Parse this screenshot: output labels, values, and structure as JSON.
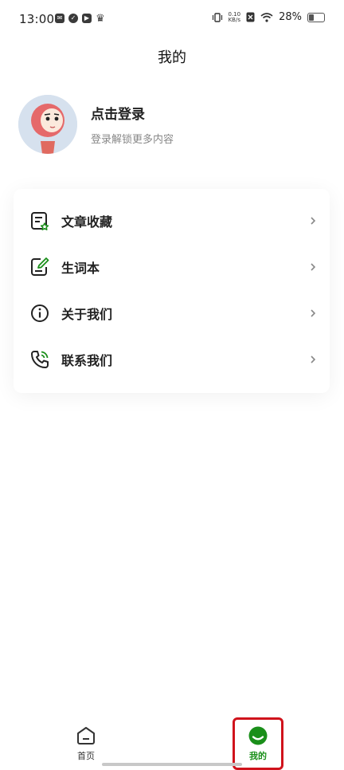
{
  "status_bar": {
    "time": "13:00",
    "net_speed_value": "0.10",
    "net_speed_unit": "KB/s",
    "battery": "28%"
  },
  "page": {
    "title": "我的"
  },
  "profile": {
    "login_title": "点击登录",
    "login_subtitle": "登录解锁更多内容"
  },
  "menu": {
    "items": [
      {
        "label": "文章收藏",
        "icon": "article-bookmark-icon"
      },
      {
        "label": "生词本",
        "icon": "vocabulary-notebook-icon"
      },
      {
        "label": "关于我们",
        "icon": "info-icon"
      },
      {
        "label": "联系我们",
        "icon": "phone-call-icon"
      }
    ]
  },
  "tabbar": {
    "tabs": [
      {
        "label": "首页",
        "icon": "home-icon",
        "active": false
      },
      {
        "label": "我的",
        "icon": "profile-icon",
        "active": true
      }
    ],
    "active_color": "#1a8f1a",
    "inactive_color": "#333333"
  },
  "colors": {
    "accent_green": "#1a8f1a",
    "highlight_red": "#d0131c"
  }
}
